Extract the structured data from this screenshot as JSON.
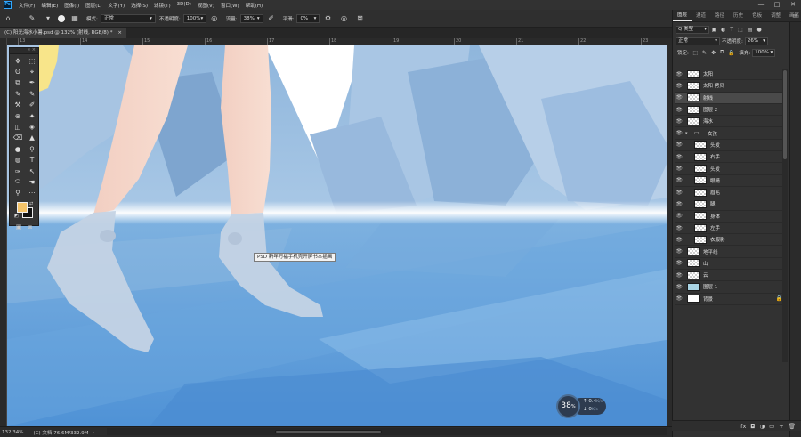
{
  "app": {
    "logo": "Ps"
  },
  "menubar": {
    "items": [
      "文件(F)",
      "编辑(E)",
      "图像(I)",
      "图层(L)",
      "文字(Y)",
      "选择(S)",
      "滤镜(T)",
      "3D(D)",
      "视图(V)",
      "窗口(W)",
      "帮助(H)"
    ],
    "window_controls": [
      "—",
      "□",
      "✕"
    ]
  },
  "options_bar": {
    "home_icon": "⌂",
    "brush_icon": "✎",
    "mode_label": "模式:",
    "mode_value": "正常",
    "opacity_label": "不透明度:",
    "opacity_value": "100%",
    "flow_label": "流量:",
    "flow_value": "38%",
    "smooth_label": "平滑:",
    "smooth_value": "0%"
  },
  "document": {
    "tab_title": "(C) 阳光海水小暑.psd @ 132% (射线, RGB/8) *",
    "tab_close": "×",
    "ruler_marks": [
      "13",
      "14",
      "15",
      "16",
      "17",
      "18",
      "19",
      "20",
      "21",
      "22",
      "23"
    ],
    "tooltip": "PSD 新年万福手机壳开屏书本插画"
  },
  "tools": {
    "icons": [
      "✥",
      "⬚",
      "ʘ",
      "⌖",
      "⧉",
      "✒",
      "✎",
      "✎",
      "⚒",
      "✐",
      "⊕",
      "✦",
      "◫",
      "◈",
      "⌫",
      "▲",
      "●",
      "⚲",
      "◍",
      "T",
      "✑",
      "↖",
      "⬭",
      "☚",
      "⚲",
      "⋯"
    ],
    "header_close": "«  ×",
    "swap": "⇄",
    "reset": "◩",
    "bottom_icons": [
      "▣",
      "⧈"
    ]
  },
  "colors": {
    "foreground": "#f5c469",
    "background": "#111111",
    "accent": "#31a8ff"
  },
  "status": {
    "zoom": "132.34%",
    "doc_info": "(C) 文档:76.6M/332.9M",
    "arrow": "›"
  },
  "perf": {
    "value": "38",
    "unit_big": "%",
    "up_value": "0.4",
    "up_unit": "K/s",
    "down_value": "0",
    "down_unit": "K/s"
  },
  "panels": {
    "tabs": [
      "图层",
      "通道",
      "路径",
      "历史",
      "色板",
      "调整",
      "画笔"
    ],
    "menu_icon": "≡",
    "kind_label": "Q 类型",
    "blend_mode": "正常",
    "opacity_label": "不透明度:",
    "opacity_value": "26%",
    "lock_label": "锁定:",
    "fill_label": "填充:",
    "fill_value": "100%",
    "layers": [
      {
        "name": "太阳",
        "type": "layer",
        "depth": 0,
        "thumb": "checker",
        "selected": false
      },
      {
        "name": "太阳 拷贝",
        "type": "layer",
        "depth": 0,
        "thumb": "checker",
        "selected": false
      },
      {
        "name": "射线",
        "type": "layer",
        "depth": 0,
        "thumb": "checker",
        "selected": true
      },
      {
        "name": "图层 2",
        "type": "layer",
        "depth": 0,
        "thumb": "checker",
        "selected": false
      },
      {
        "name": "海水",
        "type": "layer",
        "depth": 0,
        "thumb": "checker",
        "selected": false
      },
      {
        "name": "女孩",
        "type": "group",
        "depth": 0,
        "thumb": "none",
        "selected": false
      },
      {
        "name": "头发",
        "type": "layer",
        "depth": 1,
        "thumb": "checker",
        "selected": false
      },
      {
        "name": "右手",
        "type": "layer",
        "depth": 1,
        "thumb": "checker",
        "selected": false
      },
      {
        "name": "头发",
        "type": "layer",
        "depth": 1,
        "thumb": "checker",
        "selected": false
      },
      {
        "name": "眼睛",
        "type": "layer",
        "depth": 1,
        "thumb": "checker",
        "selected": false
      },
      {
        "name": "眉毛",
        "type": "layer",
        "depth": 1,
        "thumb": "checker",
        "selected": false
      },
      {
        "name": "腿",
        "type": "layer",
        "depth": 1,
        "thumb": "checker",
        "selected": false
      },
      {
        "name": "身体",
        "type": "layer",
        "depth": 1,
        "thumb": "checker",
        "selected": false
      },
      {
        "name": "左手",
        "type": "layer",
        "depth": 1,
        "thumb": "checker",
        "selected": false
      },
      {
        "name": "衣服影",
        "type": "layer",
        "depth": 1,
        "thumb": "checker",
        "selected": false
      },
      {
        "name": "地平线",
        "type": "layer",
        "depth": 0,
        "thumb": "checker",
        "selected": false
      },
      {
        "name": "山",
        "type": "layer",
        "depth": 0,
        "thumb": "checker",
        "selected": false
      },
      {
        "name": "云",
        "type": "layer",
        "depth": 0,
        "thumb": "checker",
        "selected": false
      },
      {
        "name": "图层 1",
        "type": "layer",
        "depth": 0,
        "thumb": "blue",
        "selected": false
      },
      {
        "name": "背景",
        "type": "layer",
        "depth": 0,
        "thumb": "white",
        "selected": false,
        "locked": true
      }
    ],
    "bottom_icons": [
      "fx",
      "◘",
      "◑",
      "▭",
      "+",
      "🗑"
    ]
  }
}
